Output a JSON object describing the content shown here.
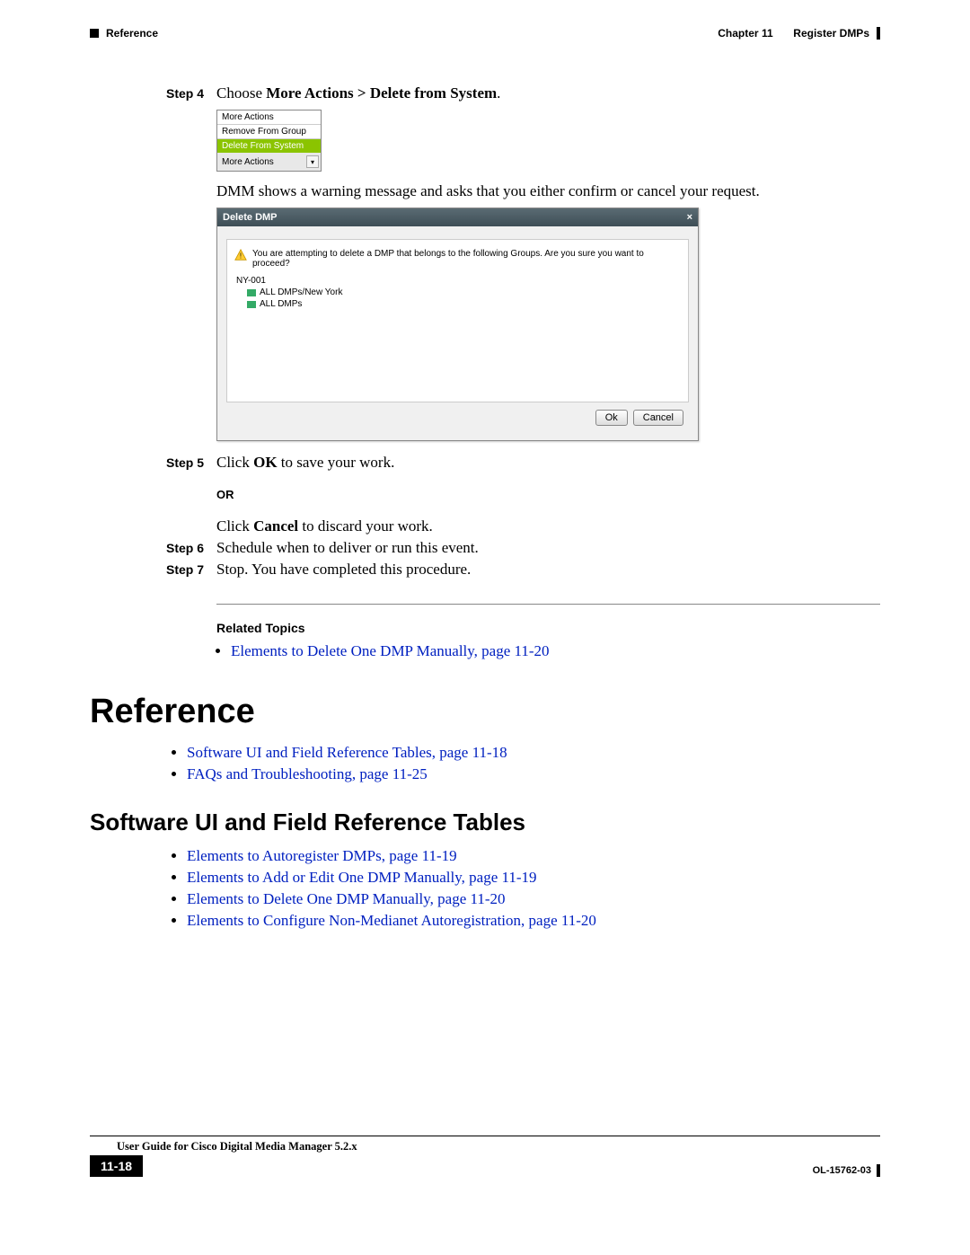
{
  "header": {
    "section": "Reference",
    "chapter": "Chapter 11",
    "chapter_title": "Register DMPs"
  },
  "steps": {
    "s4": {
      "label": "Step 4",
      "prefix": "Choose ",
      "bold": "More Actions > Delete from System",
      "suffix": "."
    },
    "dropdown": {
      "opt1": "More Actions",
      "opt2": "Remove From Group",
      "opt3": "Delete From System",
      "btn": "More Actions"
    },
    "dmm_text": "DMM shows a warning message and asks that you either confirm or cancel your request.",
    "dialog": {
      "title": "Delete DMP",
      "close": "×",
      "warning": "You are attempting to delete a DMP that belongs to the following Groups. Are you sure you want to proceed?",
      "item": "NY-001",
      "sub1": "ALL DMPs/New York",
      "sub2": "ALL DMPs",
      "ok": "Ok",
      "cancel": "Cancel"
    },
    "s5": {
      "label": "Step 5",
      "prefix": "Click ",
      "bold": "OK",
      "suffix": " to save your work."
    },
    "or": "OR",
    "s5b": {
      "prefix": "Click ",
      "bold": "Cancel",
      "suffix": " to discard your work."
    },
    "s6": {
      "label": "Step 6",
      "text": "Schedule when to deliver or run this event."
    },
    "s7": {
      "label": "Step 7",
      "text": "Stop. You have completed this procedure."
    }
  },
  "related": {
    "title": "Related Topics",
    "item1": "Elements to Delete One DMP Manually, page 11-20"
  },
  "reference": {
    "h1": "Reference",
    "link1": "Software UI and Field Reference Tables, page 11-18",
    "link2": "FAQs and Troubleshooting, page 11-25"
  },
  "software": {
    "h2": "Software UI and Field Reference Tables",
    "l1": "Elements to Autoregister DMPs, page 11-19",
    "l2": "Elements to Add or Edit One DMP Manually, page 11-19",
    "l3": "Elements to Delete One DMP Manually, page 11-20",
    "l4": "Elements to Configure Non-Medianet Autoregistration, page 11-20"
  },
  "footer": {
    "guide": "User Guide for Cisco Digital Media Manager 5.2.x",
    "page": "11-18",
    "docid": "OL-15762-03"
  }
}
